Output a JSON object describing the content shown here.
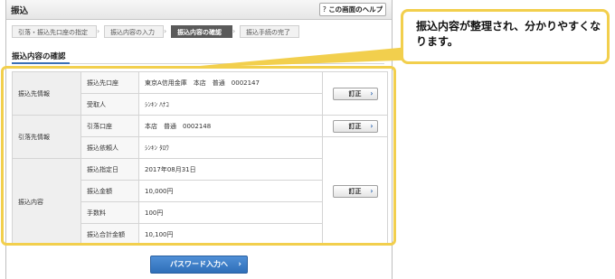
{
  "header": {
    "title": "振込",
    "help_label": "この画面のヘルプ",
    "help_icon": "question-icon"
  },
  "steps": [
    {
      "label": "引落・振込先口座の指定",
      "active": false
    },
    {
      "label": "振込内容の入力",
      "active": false
    },
    {
      "label": "振込内容の確認",
      "active": true
    },
    {
      "label": "振込手続の完了",
      "active": false
    }
  ],
  "section": {
    "title": "振込内容の確認"
  },
  "table": {
    "transfer_to": {
      "category": "振込先情報",
      "account_label": "振込先口座",
      "account_value": "東京A信用金庫　本店　普通　0002147",
      "recipient_label": "受取人",
      "recipient_value": "ｼﾝｷﾝ ﾊﾅｺ",
      "edit": "訂正"
    },
    "debit": {
      "category": "引落先情報",
      "account_label": "引落口座",
      "account_value": "本店　普通　0002148",
      "requester_label": "振込依頼人",
      "requester_value": "ｼﾝｷﾝ ﾀﾛｳ",
      "edit": "訂正"
    },
    "content": {
      "category": "振込内容",
      "date_label": "振込指定日",
      "date_value": "2017年08月31日",
      "amount_label": "振込金額",
      "amount_value": "10,000円",
      "fee_label": "手数料",
      "fee_value": "100円",
      "total_label": "振込合計金額",
      "total_value": "10,100円",
      "edit": "訂正"
    }
  },
  "footer": {
    "password_button": "パスワード入力へ"
  },
  "callout": {
    "text": "振込内容が整理され、分かりやすくなります。"
  },
  "colors": {
    "highlight": "#f2cf4d",
    "primary_button": "#2f6fb9",
    "active_step": "#5a5a5a"
  }
}
